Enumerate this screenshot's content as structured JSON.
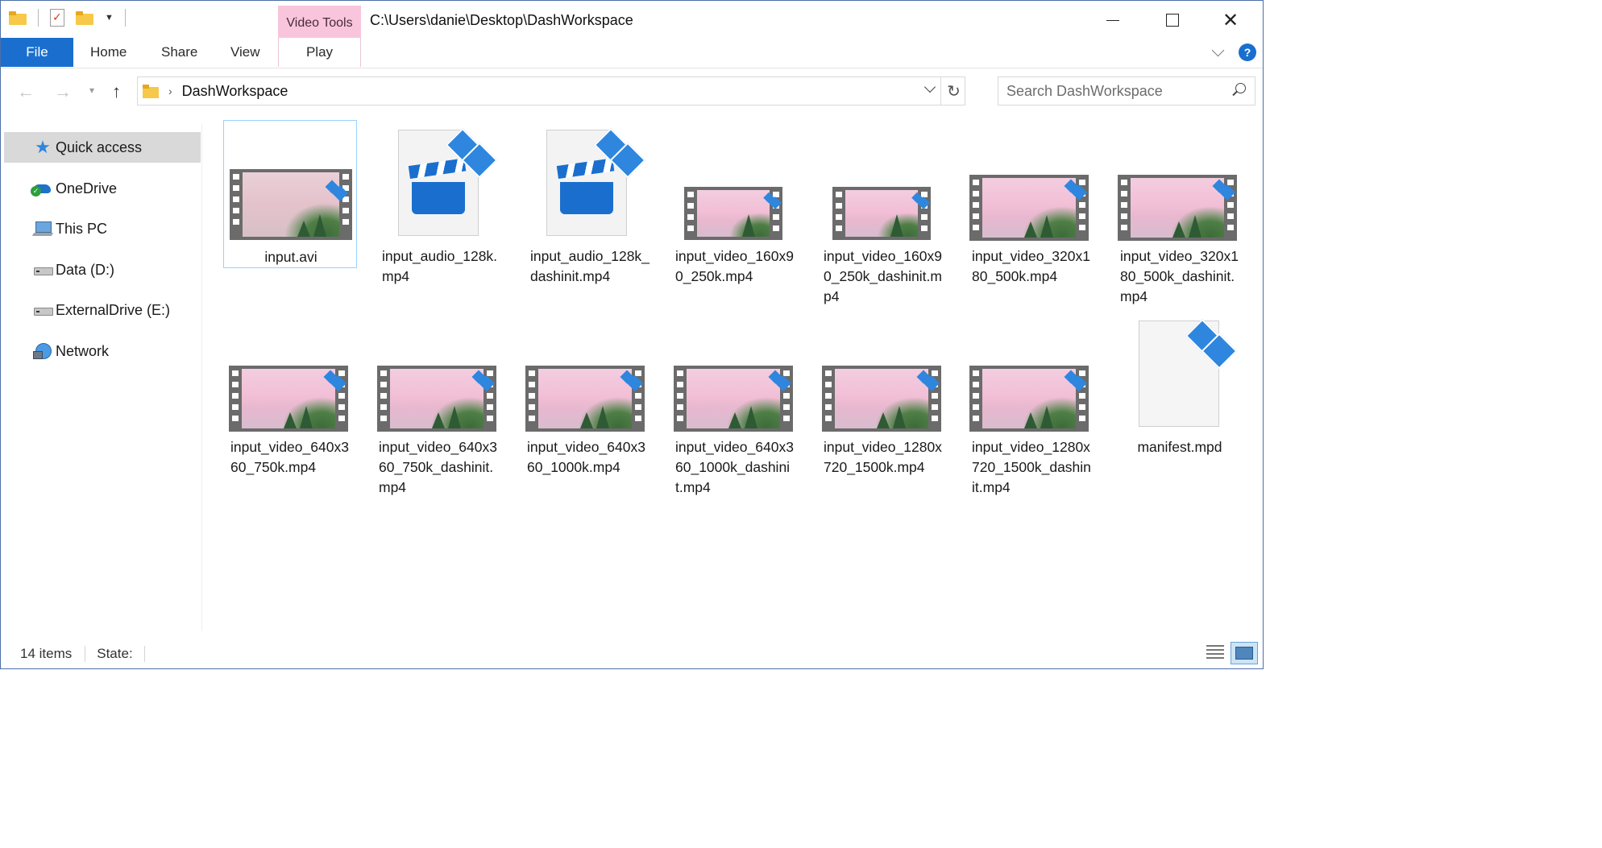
{
  "window": {
    "title": "C:\\Users\\danie\\Desktop\\DashWorkspace",
    "context_tab_group": "Video Tools"
  },
  "ribbon": {
    "tabs": [
      "File",
      "Home",
      "Share",
      "View",
      "Play"
    ]
  },
  "navigation": {
    "breadcrumb": "DashWorkspace",
    "search_placeholder": "Search DashWorkspace"
  },
  "sidebar": {
    "items": [
      {
        "label": "Quick access",
        "icon": "star-icon",
        "selected": true
      },
      {
        "label": "OneDrive",
        "icon": "cloud-icon"
      },
      {
        "label": "This PC",
        "icon": "computer-icon"
      },
      {
        "label": "Data (D:)",
        "icon": "drive-icon"
      },
      {
        "label": "ExternalDrive (E:)",
        "icon": "drive-icon"
      },
      {
        "label": "Network",
        "icon": "network-icon"
      }
    ]
  },
  "files": [
    {
      "name": "input.avi",
      "kind": "video-thumb",
      "selected": true
    },
    {
      "name": "input_audio_128k.mp4",
      "kind": "audio-doc"
    },
    {
      "name": "input_audio_128k_dashinit.mp4",
      "kind": "audio-doc"
    },
    {
      "name": "input_video_160x90_250k.mp4",
      "kind": "video-thumb"
    },
    {
      "name": "input_video_160x90_250k_dashinit.mp4",
      "kind": "video-thumb"
    },
    {
      "name": "input_video_320x180_500k.mp4",
      "kind": "video-thumb"
    },
    {
      "name": "input_video_320x180_500k_dashinit.mp4",
      "kind": "video-thumb"
    },
    {
      "name": "input_video_640x360_750k.mp4",
      "kind": "video-thumb"
    },
    {
      "name": "input_video_640x360_750k_dashinit.mp4",
      "kind": "video-thumb"
    },
    {
      "name": "input_video_640x360_1000k.mp4",
      "kind": "video-thumb"
    },
    {
      "name": "input_video_640x360_1000k_dashinit.mp4",
      "kind": "video-thumb"
    },
    {
      "name": "input_video_1280x720_1500k.mp4",
      "kind": "video-thumb"
    },
    {
      "name": "input_video_1280x720_1500k_dashinit.mp4",
      "kind": "video-thumb"
    },
    {
      "name": "manifest.mpd",
      "kind": "blank-doc"
    }
  ],
  "status": {
    "item_count": "14 items",
    "state_label": "State:"
  },
  "colors": {
    "accent": "#1a6fce",
    "context_tab": "#f8c5dd",
    "selection_border": "#99d1ff"
  }
}
